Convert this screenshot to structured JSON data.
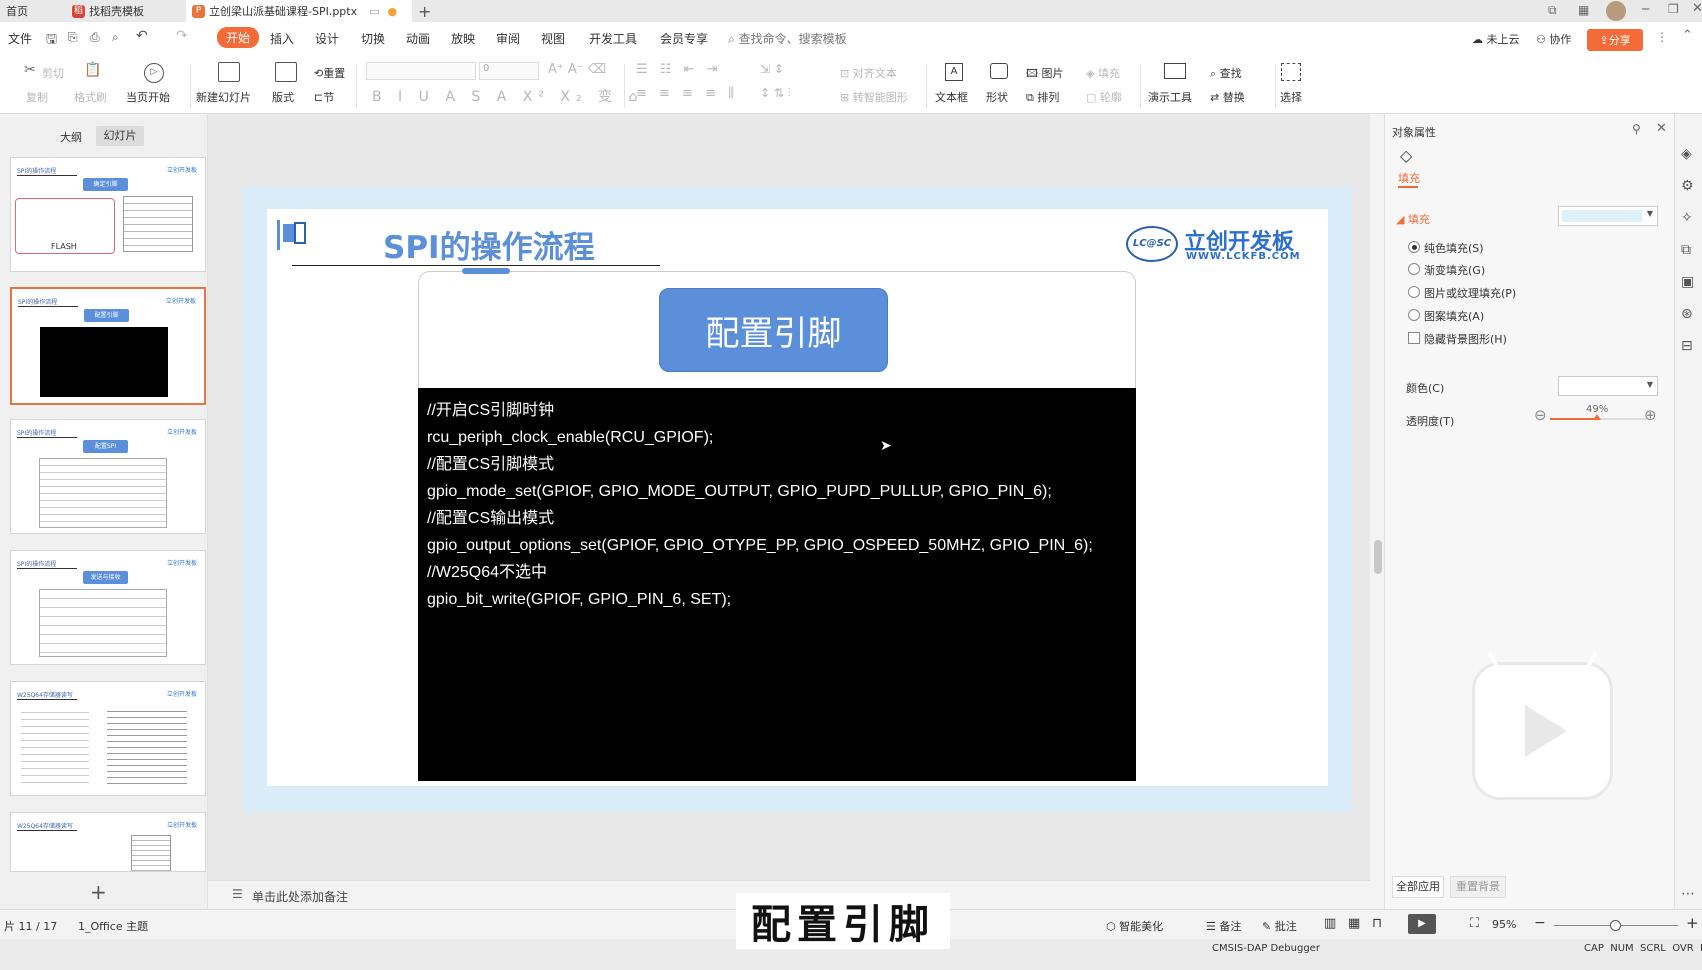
{
  "tabs": [
    {
      "label": "首页"
    },
    {
      "label": "找稻壳模板"
    },
    {
      "label": "立创梁山派基础课程-SPI.pptx"
    }
  ],
  "menu": [
    "文件",
    "开始",
    "插入",
    "设计",
    "切换",
    "动画",
    "放映",
    "审阅",
    "视图",
    "开发工具",
    "会员专享"
  ],
  "search_placeholder": "查找命令、搜索模板",
  "top_right": {
    "cloud": "未上云",
    "collab": "协作",
    "share": "分享"
  },
  "ribbon": {
    "cut": "剪切",
    "copy": "复制",
    "format_painter": "格式刷",
    "from_current": "当页开始",
    "new_slide": "新建幻灯片",
    "layout": "版式",
    "reset": "重置",
    "section": "节",
    "font_size": "0",
    "align_text": "对齐文本",
    "smart_art": "转智能图形",
    "textbox": "文本框",
    "shape": "形状",
    "picture": "图片",
    "fill": "填充",
    "arrange": "排列",
    "outline": "轮廓",
    "presenter_tools": "演示工具",
    "find": "查找",
    "replace": "替换",
    "select": "选择"
  },
  "left_panel": {
    "tab_outline": "大纲",
    "tab_slides": "幻灯片"
  },
  "thumbnails": [
    {
      "title": "SPI的操作流程",
      "button": "确定引脚",
      "extra": "FLASH"
    },
    {
      "title": "SPI的操作流程",
      "button": "配置引脚"
    },
    {
      "title": "SPI的操作流程",
      "button": "配置SPI"
    },
    {
      "title": "SPI的操作流程",
      "button": "发送与接收"
    },
    {
      "title": "W25Q64存储器读写"
    },
    {
      "title": "W25Q64存储器读写"
    }
  ],
  "slide": {
    "title": "SPI的操作流程",
    "logo_main": "立创开发板",
    "logo_prefix": "LC@SC",
    "logo_url": "WWW.LCKFB.COM",
    "button": "配置引脚",
    "code_lines": [
      "//开启CS引脚时钟",
      "rcu_periph_clock_enable(RCU_GPIOF);",
      "//配置CS引脚模式",
      "gpio_mode_set(GPIOF, GPIO_MODE_OUTPUT, GPIO_PUPD_PULLUP, GPIO_PIN_6);",
      "//配置CS输出模式",
      "gpio_output_options_set(GPIOF, GPIO_OTYPE_PP, GPIO_OSPEED_50MHZ, GPIO_PIN_6);",
      "//W25Q64不选中",
      "gpio_bit_write(GPIOF, GPIO_PIN_6, SET);"
    ]
  },
  "notes_placeholder": "单击此处添加备注",
  "right_panel": {
    "title": "对象属性",
    "tab_fill": "填充",
    "section_fill": "填充",
    "options": [
      {
        "label": "纯色填充(S)",
        "checked": true
      },
      {
        "label": "渐变填充(G)",
        "checked": false
      },
      {
        "label": "图片或纹理填充(P)",
        "checked": false
      },
      {
        "label": "图案填充(A)",
        "checked": false
      }
    ],
    "hide_bg": "隐藏背景图形(H)",
    "color_label": "颜色(C)",
    "transparency_label": "透明度(T)",
    "transparency_value": "49%",
    "transparency": 0.49,
    "fill_color": "#dff0fa",
    "apply_all": "全部应用",
    "reset_bg": "重置背景"
  },
  "status": {
    "page": "片 11 / 17",
    "theme": "1_Office 主题",
    "smart_beautify": "智能美化",
    "notes": "备注",
    "comments": "批注",
    "zoom": "95%",
    "zoom_fraction": 0.49
  },
  "subtitle": "配置引脚",
  "bottom": {
    "debugger": "CMSIS-DAP Debugger",
    "keys": "CAP  NUM  SCRL  OVR  R/W"
  },
  "colors": {
    "accent": "#f46b3a",
    "slide_blue": "#5b8fd9",
    "selected_thumb": "#e8743b"
  }
}
